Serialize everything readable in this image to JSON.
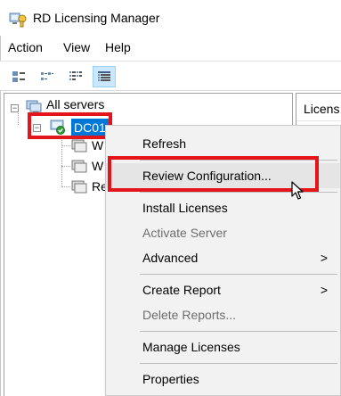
{
  "window": {
    "title": "RD Licensing Manager"
  },
  "menubar": {
    "items": [
      "Action",
      "View",
      "Help"
    ]
  },
  "toolbar": {
    "buttons": [
      "large-icons",
      "small-icons",
      "list",
      "details"
    ],
    "active": "details"
  },
  "tree": {
    "root_label": "All servers",
    "server_label": "DC01",
    "children": [
      {
        "label": "W"
      },
      {
        "label": "W"
      },
      {
        "label": "Re"
      }
    ]
  },
  "right_pane": {
    "header": "Licens"
  },
  "context_menu": {
    "items": [
      {
        "label": "Refresh",
        "enabled": true
      },
      {
        "label": "Review Configuration...",
        "enabled": true,
        "highlighted": true
      },
      {
        "label": "Install Licenses",
        "enabled": true
      },
      {
        "label": "Activate Server",
        "enabled": false
      },
      {
        "label": "Advanced",
        "enabled": true,
        "submenu": true
      },
      {
        "label": "Create Report",
        "enabled": true,
        "submenu": true
      },
      {
        "label": "Delete Reports...",
        "enabled": false
      },
      {
        "label": "Manage Licenses",
        "enabled": true
      },
      {
        "label": "Properties",
        "enabled": true
      }
    ],
    "submenu_arrow": ">"
  },
  "colors": {
    "selection": "#0078d7",
    "annotation_red": "#e3151b",
    "menu_background": "#f2f2f2",
    "disabled_text": "#6d6d6d"
  },
  "icons": {
    "app": "licensing-manager-icon",
    "root": "server-group-icon",
    "server": "server-ok-icon",
    "child": "license-node-icon",
    "cursor": "mouse-pointer-icon"
  }
}
